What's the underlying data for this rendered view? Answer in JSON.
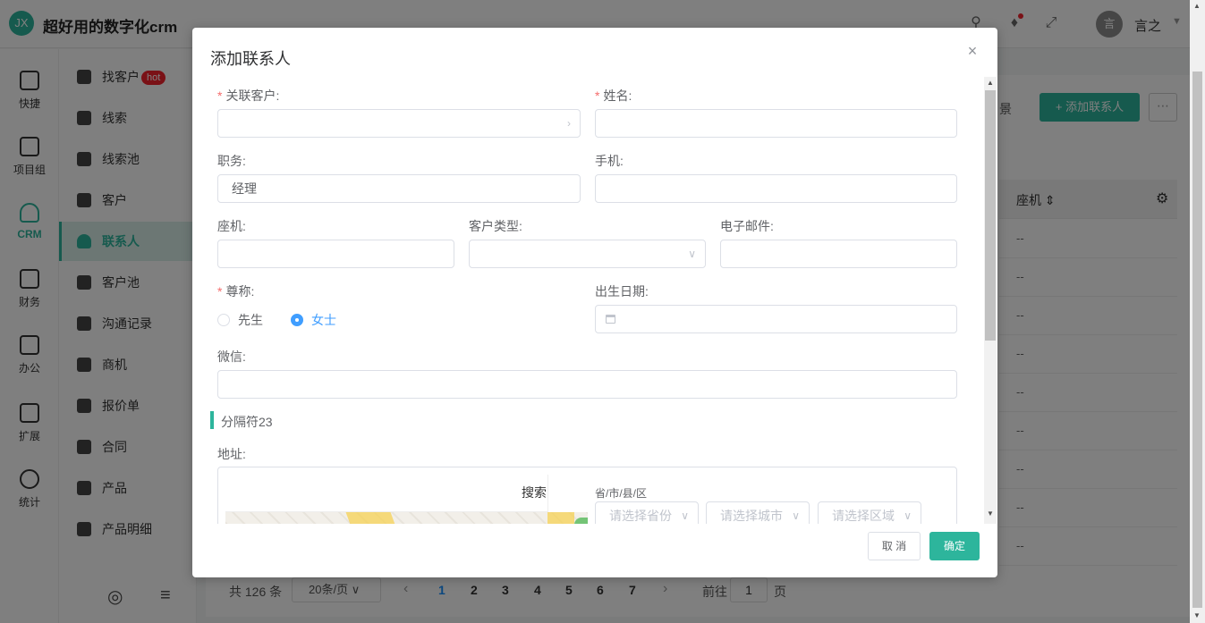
{
  "app": {
    "logo_text": "JX",
    "title": "超好用的数字化crm"
  },
  "header": {
    "avatar_text": "言",
    "user_name": "言之"
  },
  "rail": [
    {
      "label": "快捷"
    },
    {
      "label": "项目组"
    },
    {
      "label": "CRM"
    },
    {
      "label": "财务"
    },
    {
      "label": "办公"
    },
    {
      "label": "扩展"
    },
    {
      "label": "统计"
    }
  ],
  "menu": [
    {
      "label": "找客户",
      "badge": "hot"
    },
    {
      "label": "线索"
    },
    {
      "label": "线索池"
    },
    {
      "label": "客户"
    },
    {
      "label": "联系人"
    },
    {
      "label": "客户池"
    },
    {
      "label": "沟通记录"
    },
    {
      "label": "商机"
    },
    {
      "label": "报价单"
    },
    {
      "label": "合同"
    },
    {
      "label": "产品"
    },
    {
      "label": "产品明细"
    }
  ],
  "background": {
    "tab_partial": "景",
    "add_button": "添加联系人",
    "column_header": "座机",
    "cell_value": "--",
    "pagination": {
      "total": "共 126 条",
      "page_size": "20条/页",
      "pages": [
        "1",
        "2",
        "3",
        "4",
        "5",
        "6",
        "7"
      ],
      "current": "1",
      "goto_label": "前往",
      "goto_value": "1",
      "page_suffix": "页"
    }
  },
  "modal": {
    "title": "添加联系人",
    "fields": {
      "customer": {
        "label": "关联客户:",
        "value": ""
      },
      "name": {
        "label": "姓名:",
        "value": ""
      },
      "position": {
        "label": "职务:",
        "value": "经理"
      },
      "mobile": {
        "label": "手机:",
        "value": ""
      },
      "landline": {
        "label": "座机:",
        "value": ""
      },
      "customer_type": {
        "label": "客户类型:",
        "value": ""
      },
      "email": {
        "label": "电子邮件:",
        "value": ""
      },
      "title": {
        "label": "尊称:",
        "options": [
          "先生",
          "女士"
        ],
        "selected": "女士"
      },
      "birthday": {
        "label": "出生日期:",
        "value": ""
      },
      "wechat": {
        "label": "微信:",
        "value": ""
      }
    },
    "divider": "分隔符23",
    "address": {
      "label": "地址:",
      "search_button": "搜索",
      "region_label": "省/市/县/区",
      "province_placeholder": "请选择省份",
      "city_placeholder": "请选择城市",
      "district_placeholder": "请选择区域"
    },
    "buttons": {
      "cancel": "取 消",
      "confirm": "确定"
    }
  },
  "colors": {
    "accent": "#2db59c",
    "radio_active": "#409eff",
    "required": "#f56c6c",
    "hot_badge": "#f5222d"
  }
}
